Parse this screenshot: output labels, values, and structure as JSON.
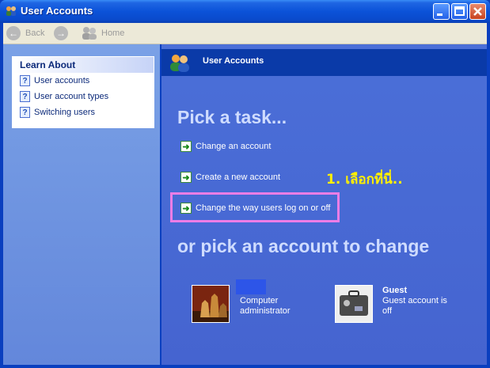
{
  "window": {
    "title": "User Accounts"
  },
  "toolbar": {
    "back_label": "Back",
    "home_label": "Home"
  },
  "sidebar": {
    "learn_about": {
      "header": "Learn About",
      "items": [
        {
          "label": "User accounts",
          "icon": "help-icon"
        },
        {
          "label": "User account types",
          "icon": "help-icon"
        },
        {
          "label": "Switching users",
          "icon": "help-icon"
        }
      ]
    }
  },
  "main": {
    "header_title": "User Accounts",
    "pick_task": "Pick a task...",
    "tasks": [
      {
        "label": "Change an account",
        "icon": "green-arrow-icon"
      },
      {
        "label": "Create a new account",
        "icon": "green-arrow-icon"
      },
      {
        "label": "Change the way users log on or off",
        "icon": "green-arrow-icon"
      }
    ],
    "annotation": "1. เลือกที่นี่..",
    "or_pick": "or pick an account to change",
    "accounts": [
      {
        "name": "",
        "type_line1": "Computer",
        "type_line2": "administrator",
        "picture": "chess-icon"
      },
      {
        "name": "Guest",
        "type_line1": "Guest account is",
        "type_line2": "off",
        "picture": "suitcase-icon"
      }
    ]
  },
  "colors": {
    "title_bar": "#0b52d8",
    "sidebar": "#6f94de",
    "main_bg": "#4a6bd6",
    "highlight": "#ec7de6",
    "annotation": "#fff000"
  }
}
